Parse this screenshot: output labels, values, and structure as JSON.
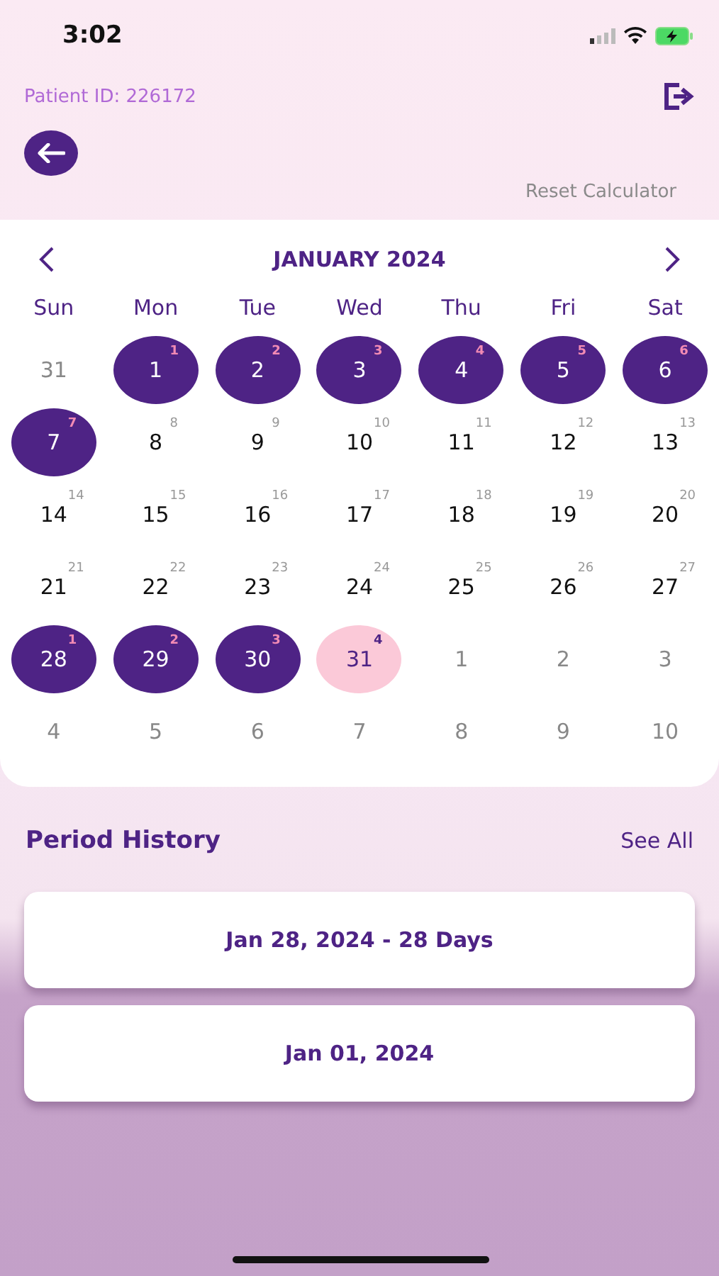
{
  "status_bar": {
    "time": "3:02"
  },
  "header": {
    "patient_id": "Patient ID: 226172",
    "reset": "Reset Calculator"
  },
  "calendar": {
    "month": "JANUARY 2024",
    "weekdays": [
      "Sun",
      "Mon",
      "Tue",
      "Wed",
      "Thu",
      "Fri",
      "Sat"
    ],
    "days": [
      {
        "day": "31",
        "kind": "outside"
      },
      {
        "day": "1",
        "cycle_day": "1",
        "kind": "period"
      },
      {
        "day": "2",
        "cycle_day": "2",
        "kind": "period"
      },
      {
        "day": "3",
        "cycle_day": "3",
        "kind": "period"
      },
      {
        "day": "4",
        "cycle_day": "4",
        "kind": "period"
      },
      {
        "day": "5",
        "cycle_day": "5",
        "kind": "period"
      },
      {
        "day": "6",
        "cycle_day": "6",
        "kind": "period"
      },
      {
        "day": "7",
        "cycle_day": "7",
        "kind": "period"
      },
      {
        "day": "8",
        "cycle_day": "8",
        "kind": "normal"
      },
      {
        "day": "9",
        "cycle_day": "9",
        "kind": "normal"
      },
      {
        "day": "10",
        "cycle_day": "10",
        "kind": "normal"
      },
      {
        "day": "11",
        "cycle_day": "11",
        "kind": "normal"
      },
      {
        "day": "12",
        "cycle_day": "12",
        "kind": "normal"
      },
      {
        "day": "13",
        "cycle_day": "13",
        "kind": "normal"
      },
      {
        "day": "14",
        "cycle_day": "14",
        "kind": "normal"
      },
      {
        "day": "15",
        "cycle_day": "15",
        "kind": "normal"
      },
      {
        "day": "16",
        "cycle_day": "16",
        "kind": "normal"
      },
      {
        "day": "17",
        "cycle_day": "17",
        "kind": "normal"
      },
      {
        "day": "18",
        "cycle_day": "18",
        "kind": "normal"
      },
      {
        "day": "19",
        "cycle_day": "19",
        "kind": "normal"
      },
      {
        "day": "20",
        "cycle_day": "20",
        "kind": "normal"
      },
      {
        "day": "21",
        "cycle_day": "21",
        "kind": "normal"
      },
      {
        "day": "22",
        "cycle_day": "22",
        "kind": "normal"
      },
      {
        "day": "23",
        "cycle_day": "23",
        "kind": "normal"
      },
      {
        "day": "24",
        "cycle_day": "24",
        "kind": "normal"
      },
      {
        "day": "25",
        "cycle_day": "25",
        "kind": "normal"
      },
      {
        "day": "26",
        "cycle_day": "26",
        "kind": "normal"
      },
      {
        "day": "27",
        "cycle_day": "27",
        "kind": "normal"
      },
      {
        "day": "28",
        "cycle_day": "1",
        "kind": "period"
      },
      {
        "day": "29",
        "cycle_day": "2",
        "kind": "period"
      },
      {
        "day": "30",
        "cycle_day": "3",
        "kind": "period"
      },
      {
        "day": "31",
        "cycle_day": "4",
        "kind": "today"
      },
      {
        "day": "1",
        "kind": "outside"
      },
      {
        "day": "2",
        "kind": "outside"
      },
      {
        "day": "3",
        "kind": "outside"
      },
      {
        "day": "4",
        "kind": "outside"
      },
      {
        "day": "5",
        "kind": "outside"
      },
      {
        "day": "6",
        "kind": "outside"
      },
      {
        "day": "7",
        "kind": "outside"
      },
      {
        "day": "8",
        "kind": "outside"
      },
      {
        "day": "9",
        "kind": "outside"
      },
      {
        "day": "10",
        "kind": "outside"
      }
    ]
  },
  "period_history": {
    "title": "Period History",
    "see_all": "See All",
    "entries": [
      "Jan 28, 2024 - 28 Days",
      "Jan 01, 2024"
    ]
  }
}
